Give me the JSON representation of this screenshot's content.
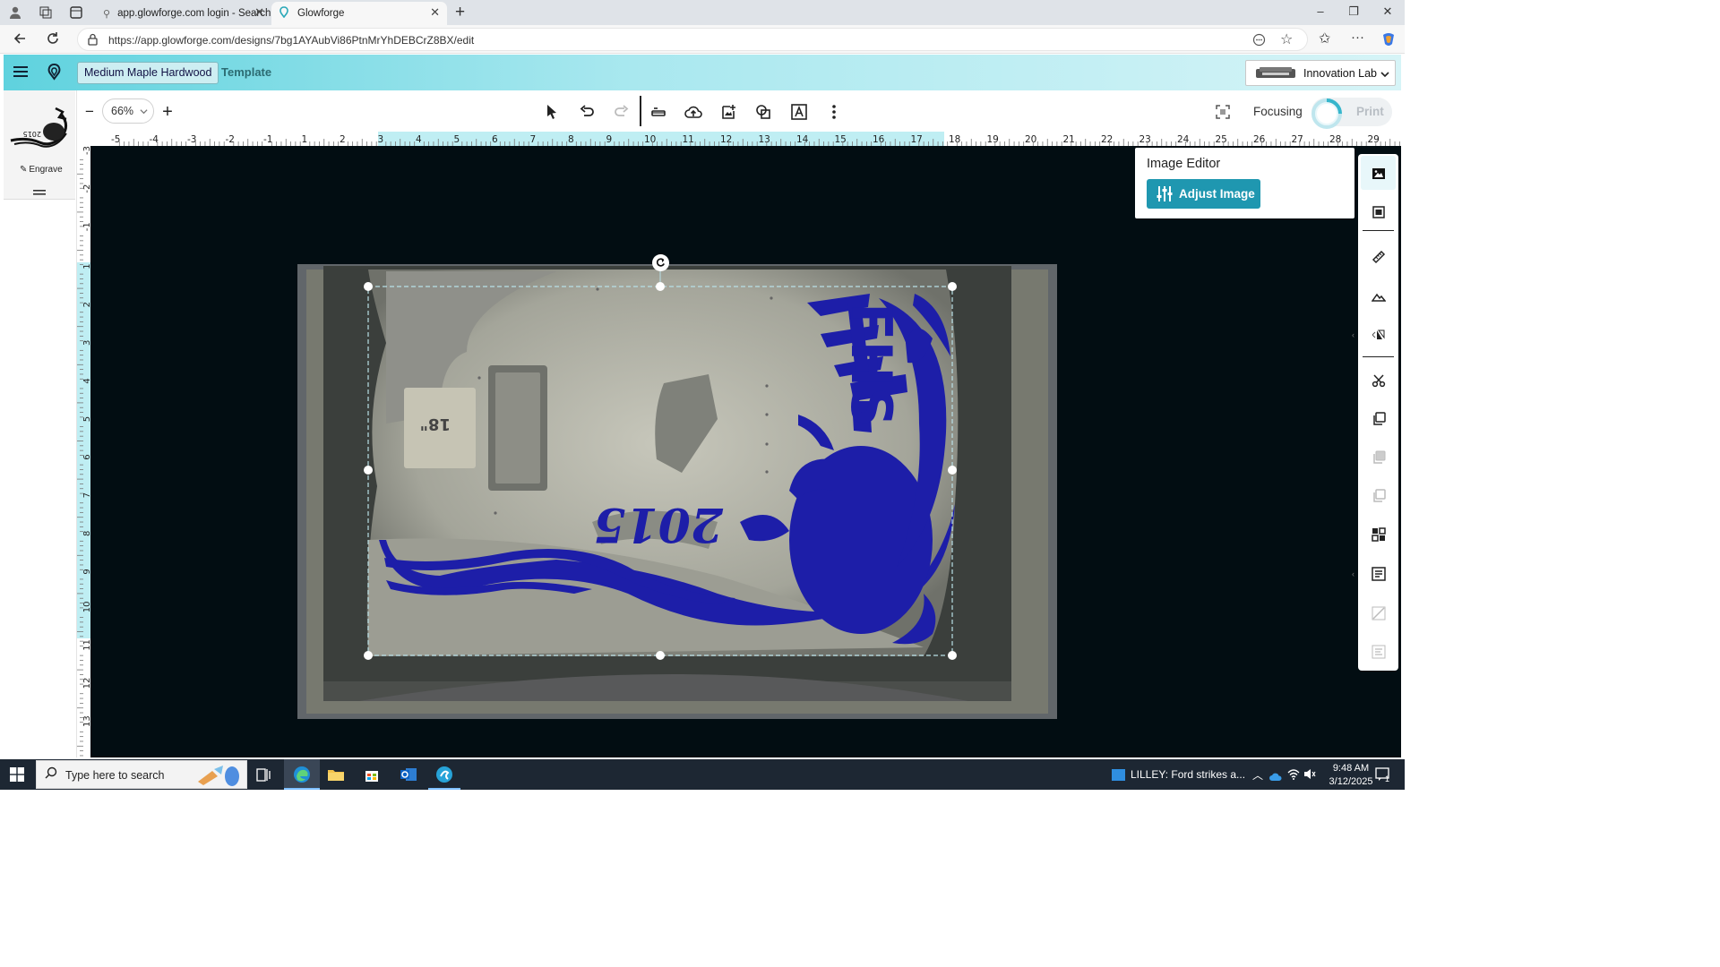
{
  "browser": {
    "tabs": [
      {
        "title": "app.glowforge.com login - Search",
        "active": false
      },
      {
        "title": "Glowforge",
        "active": true
      }
    ],
    "url": "https://app.glowforge.com/designs/7bg1AYAubVi86PtnMrYhDEBCrZ8BX/edit",
    "window_controls": {
      "minimize": "–",
      "maximize": "❐",
      "close": "✕"
    }
  },
  "app": {
    "material": "Medium Maple Hardwood",
    "template": "Template",
    "printer": "Innovation Lab",
    "left_panel": {
      "mode_label": "Engrave"
    },
    "toolbar": {
      "zoom": "66%",
      "focusing": "Focusing",
      "print": "Print"
    },
    "rulers": {
      "top_labels": [
        "-5",
        "-4",
        "-3",
        "-2",
        "-1",
        "1",
        "2",
        "3",
        "4",
        "5",
        "6",
        "7",
        "8",
        "9",
        "10",
        "11",
        "12",
        "13",
        "14",
        "15",
        "16",
        "17",
        "18",
        "19",
        "20",
        "21",
        "22",
        "23",
        "24",
        "25",
        "26",
        "27",
        "28",
        "29"
      ],
      "left_labels": [
        "-3",
        "-2",
        "-1",
        "1",
        "2",
        "3",
        "4",
        "5",
        "6",
        "7",
        "8",
        "9",
        "10",
        "11",
        "12",
        "13"
      ]
    },
    "design": {
      "year_text": "2015",
      "letters_text": "FHS",
      "tag_text": "18\""
    },
    "image_editor": {
      "title": "Image Editor",
      "button": "Adjust Image"
    },
    "colors": {
      "accent": "#1f97b0",
      "design_blue": "#1d1ea8",
      "canvas_bg": "#020d12"
    }
  },
  "taskbar": {
    "search_placeholder": "Type here to search",
    "news": "LILLEY: Ford strikes a...",
    "time": "9:48 AM",
    "date": "3/12/2025",
    "notifications": "1"
  }
}
